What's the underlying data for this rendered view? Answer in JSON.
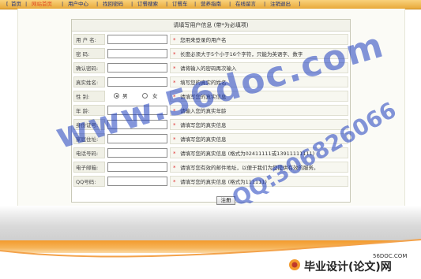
{
  "nav": {
    "items": [
      {
        "label": "首页",
        "current": false
      },
      {
        "label": "网站首页",
        "current": true
      },
      {
        "label": "用户中心",
        "current": false
      },
      {
        "label": "找回密码",
        "current": false
      },
      {
        "label": "订餐搜索",
        "current": false
      },
      {
        "label": "订餐车",
        "current": false
      },
      {
        "label": "营养指南",
        "current": false
      },
      {
        "label": "在线留言",
        "current": false
      },
      {
        "label": "注销退出",
        "current": false
      }
    ]
  },
  "form": {
    "title": "请填写用户信息 (带*为必填项)",
    "required_mark": "*",
    "rows": [
      {
        "label": "用 户 名:",
        "value": "",
        "hint": "您用来登录的用户名"
      },
      {
        "label": "密    码:",
        "value": "",
        "hint": "长度必须大于5个小于16个字符，只能为英语字、数字"
      },
      {
        "label": "确认密码:",
        "value": "",
        "hint": "请将输入的密码再次输入"
      },
      {
        "label": "真实姓名:",
        "value": "",
        "hint": "填写您的真实的姓名"
      },
      {
        "label": "性    别:",
        "type": "radio",
        "options": [
          "男",
          "女"
        ],
        "selected": "男",
        "hint": "请填写您的真实信息"
      },
      {
        "label": "年    龄:",
        "value": "",
        "hint": "请输入您的真实年龄"
      },
      {
        "label": "身份证号:",
        "value": "",
        "hint": "请填写您的真实信息"
      },
      {
        "label": "家庭住址:",
        "value": "",
        "hint": "请填写您的真实信息"
      },
      {
        "label": "电话号码:",
        "value": "",
        "hint": "请填写您的真实信息 (格式为02411111或13911111111)"
      },
      {
        "label": "电子邮箱:",
        "value": "",
        "hint": "请填写您有效的邮件地址，以便于我们为您提供有效的服务。"
      },
      {
        "label": "QQ号码:",
        "value": "",
        "hint": "请填写您的真实信息 (格式为111111)"
      }
    ],
    "submit_label": "注册"
  },
  "watermarks": {
    "site": "www.56doc.com",
    "qq": "QQ:306826066",
    "brand": "毕业设计(论文)网",
    "brand_small": "56DOC.COM"
  },
  "colors": {
    "nav_bg": "#f0b852",
    "nav_text": "#1a2e7a",
    "nav_current": "#e0451c",
    "required": "#e03030",
    "watermark": "#1f3fbf",
    "orange_band": "#f39a2c"
  }
}
